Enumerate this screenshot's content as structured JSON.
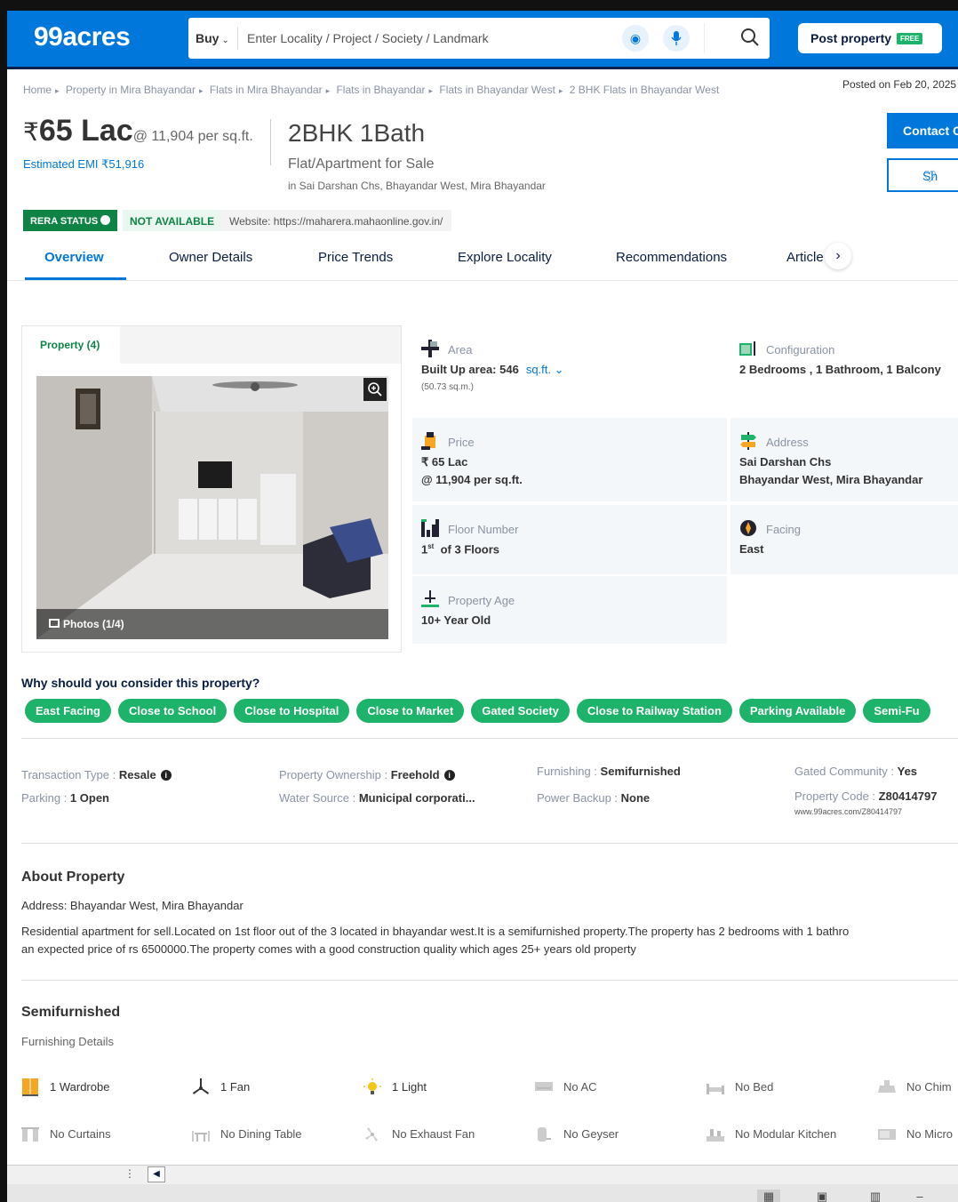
{
  "header": {
    "logo": "99acres",
    "buy_label": "Buy",
    "search_placeholder": "Enter Locality / Project / Society / Landmark",
    "post_label": "Post property",
    "free_badge": "FREE"
  },
  "breadcrumb": [
    "Home",
    "Property in Mira Bhayandar",
    "Flats in Mira Bhayandar",
    "Flats in Bhayandar",
    "Flats in Bhayandar West",
    "2 BHK Flats in Bhayandar West"
  ],
  "posted": "Posted on Feb 20, 2025",
  "summary": {
    "rupee": "₹",
    "price": "65 Lac",
    "per_sqft": "@ 11,904 per sq.ft.",
    "emi": "Estimated EMI ₹51,916",
    "title": "2BHK 1Bath",
    "subtitle": "Flat/Apartment for Sale",
    "location": "in Sai Darshan Chs, Bhayandar West, Mira Bhayandar"
  },
  "actions": {
    "contact": "Contact O",
    "shortlist": "Sh"
  },
  "rera": {
    "status": "RERA STATUS",
    "availability": "NOT AVAILABLE",
    "website": "Website: https://maharera.mahaonline.gov.in/"
  },
  "tabs": [
    "Overview",
    "Owner Details",
    "Price Trends",
    "Explore Locality",
    "Recommendations",
    "Article"
  ],
  "gallery": {
    "tab": "Property (4)",
    "photos": "Photos (1/4)"
  },
  "details": {
    "area": {
      "label": "Area",
      "value": "Built Up area: 546",
      "unit": "sq.ft.",
      "sub": "(50.73 sq.m.)"
    },
    "configuration": {
      "label": "Configuration",
      "value": "2 Bedrooms , 1 Bathroom, 1 Balcony"
    },
    "price": {
      "label": "Price",
      "value": "₹ 65 Lac",
      "value2": "@ 11,904 per sq.ft."
    },
    "address": {
      "label": "Address",
      "value": "Sai Darshan Chs",
      "value2": "Bhayandar West, Mira Bhayandar"
    },
    "floor": {
      "label": "Floor Number",
      "ordinal": "1",
      "sup": "st",
      "value": "of 3 Floors"
    },
    "facing": {
      "label": "Facing",
      "value": "East"
    },
    "age": {
      "label": "Property Age",
      "value": "10+ Year Old"
    }
  },
  "why": {
    "heading": "Why should you consider this property?",
    "chips": [
      "East Facing",
      "Close to School",
      "Close to Hospital",
      "Close to Market",
      "Gated Society",
      "Close to Railway Station",
      "Parking Available",
      "Semi-Fu"
    ]
  },
  "attributes": {
    "transaction": {
      "label": "Transaction Type : ",
      "value": "Resale"
    },
    "parking": {
      "label": "Parking : ",
      "value": "1 Open"
    },
    "ownership": {
      "label": "Property Ownership : ",
      "value": "Freehold"
    },
    "water": {
      "label": "Water Source : ",
      "value": "Municipal corporati..."
    },
    "furnishing": {
      "label": "Furnishing : ",
      "value": "Semifurnished"
    },
    "power": {
      "label": "Power Backup : ",
      "value": "None"
    },
    "gated": {
      "label": "Gated Community : ",
      "value": "Yes"
    },
    "code": {
      "label": "Property Code : ",
      "value": "Z80414797"
    },
    "code_url": "www.99acres.com/Z80414797"
  },
  "about": {
    "heading": "About Property",
    "address": "Address: Bhayandar West, Mira Bhayandar",
    "line1": "Residential apartment for sell.Located on 1st floor out of the 3 located in bhayandar west.It is a semifurnished property.The property has 2 bedrooms with 1 bathro",
    "line2": "an expected price of rs 6500000.The property comes with a good construction quality which ages 25+ years old property"
  },
  "furnishing": {
    "heading": "Semifurnished",
    "sub": "Furnishing Details",
    "items": [
      {
        "label": "1 Wardrobe",
        "icon": "wardrobe-icon"
      },
      {
        "label": "1 Fan",
        "icon": "fan-icon"
      },
      {
        "label": "1 Light",
        "icon": "light-icon"
      },
      {
        "label": "No AC",
        "icon": "ac-icon"
      },
      {
        "label": "No Bed",
        "icon": "bed-icon"
      },
      {
        "label": "No Chim",
        "icon": "chimney-icon"
      },
      {
        "label": "No Curtains",
        "icon": "curtains-icon"
      },
      {
        "label": "No Dining Table",
        "icon": "dining-table-icon"
      },
      {
        "label": "No Exhaust Fan",
        "icon": "exhaust-fan-icon"
      },
      {
        "label": "No Geyser",
        "icon": "geyser-icon"
      },
      {
        "label": "No Modular Kitchen",
        "icon": "modular-kitchen-icon"
      },
      {
        "label": "No Micro",
        "icon": "microwave-icon"
      }
    ]
  },
  "colors": {
    "brand": "#0078DB",
    "green": "#1DB36A",
    "rera_green": "#0E8345"
  }
}
